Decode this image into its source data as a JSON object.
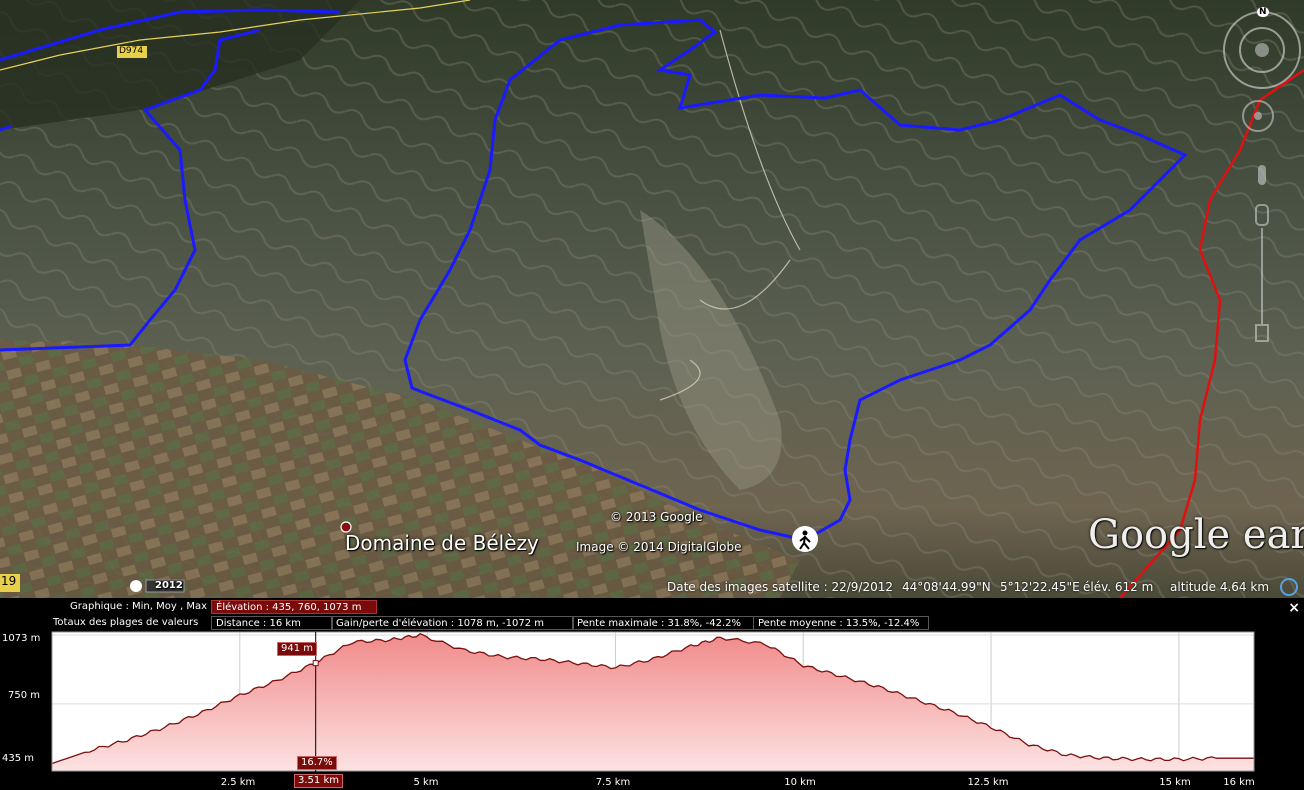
{
  "map": {
    "place_label": "Domaine de Bélèzy",
    "road_label": "D974",
    "road_label_left": "19",
    "copyright": "© 2013 Google",
    "imagery_credit": "Image © 2014 DigitalGlobe",
    "logo": "Google earth",
    "history_year": "2012",
    "compass_letter": "N",
    "colors": {
      "route_blue": "#1a1aff",
      "route_red": "#e01010"
    }
  },
  "status": {
    "image_date": "Date des images satellite : 22/9/2012",
    "lat": "44°08'44.99\"N",
    "lon": "5°12'22.45\"E",
    "elev": "élév.  612 m",
    "altitude": "altitude   4.64 km"
  },
  "profile": {
    "graph_label": "Graphique : Min, Moy , Max",
    "elevation_stats": "Élévation : 435, 760, 1073 m",
    "totals_label": "Totaux des plages de valeurs",
    "distance": "Distance : 16 km",
    "gain_loss": "Gain/perte d'élévation : 1078 m, -1072 m",
    "max_slope": "Pente maximale : 31.8%, -42.2%",
    "avg_slope": "Pente moyenne : 13.5%, -12.4%",
    "close": "×",
    "cursor_elev": "941 m",
    "cursor_slope": "16.7%",
    "cursor_dist": "3.51 km",
    "y_ticks": [
      "1073 m",
      "750 m",
      "435 m"
    ],
    "x_ticks": [
      "2.5 km",
      "5 km",
      "7.5 km",
      "10 km",
      "12.5 km",
      "15 km",
      "16 km"
    ]
  },
  "chart_data": {
    "type": "area",
    "xlabel": "",
    "ylabel": "",
    "x_unit": "km",
    "y_unit": "m",
    "xlim": [
      0,
      16
    ],
    "ylim": [
      435,
      1073
    ],
    "x": [
      0,
      0.5,
      1,
      1.5,
      2,
      2.5,
      3,
      3.5,
      4,
      4.5,
      4.9,
      5.5,
      6,
      6.5,
      7,
      7.5,
      8,
      8.5,
      8.9,
      9.5,
      10,
      10.5,
      11,
      11.5,
      12,
      12.5,
      13,
      13.5,
      14,
      14.5,
      15,
      15.5,
      16
    ],
    "y": [
      470,
      530,
      580,
      640,
      710,
      790,
      860,
      941,
      1040,
      1050,
      1073,
      1000,
      970,
      960,
      940,
      920,
      960,
      1020,
      1060,
      1030,
      930,
      880,
      830,
      770,
      710,
      640,
      560,
      510,
      495,
      490,
      490,
      495,
      495
    ],
    "grid": true
  }
}
